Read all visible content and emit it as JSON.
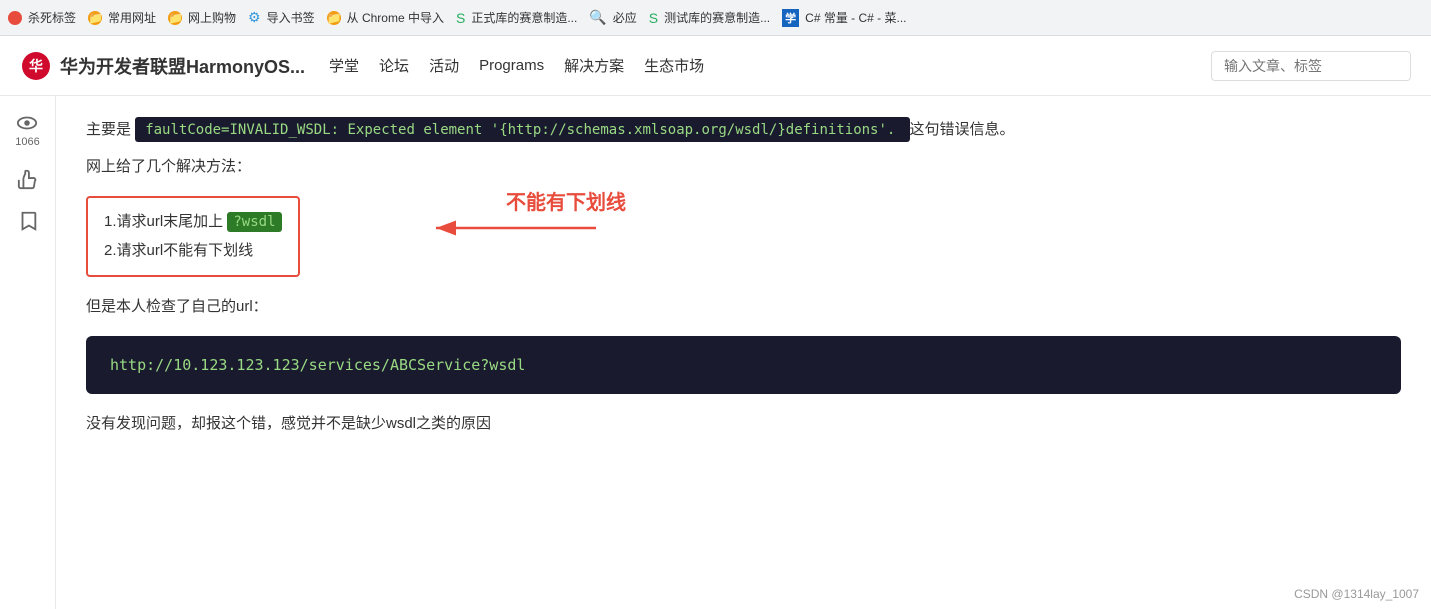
{
  "browser": {
    "tabs": [
      {
        "label": "杀死标签",
        "iconColor": "red"
      },
      {
        "label": "常用网址",
        "iconColor": "orange"
      },
      {
        "label": "网上购物",
        "iconColor": "orange"
      },
      {
        "label": "导入书签",
        "iconColor": "blue"
      },
      {
        "label": "从 Chrome 中导入",
        "iconColor": "orange"
      },
      {
        "label": "正式库的赛意制造...",
        "iconColor": "green"
      },
      {
        "label": "必应",
        "iconColor": "blue"
      },
      {
        "label": "测试库的赛意制造...",
        "iconColor": "green"
      },
      {
        "label": "C# 常量 - C# - 菜...",
        "iconColor": "cyan"
      }
    ]
  },
  "header": {
    "logo_alt": "Huawei Logo",
    "site_title": "华为开发者联盟HarmonyOS...",
    "nav": [
      "学堂",
      "论坛",
      "活动",
      "Programs",
      "解决方案",
      "生态市场"
    ],
    "search_placeholder": "输入文章、标签"
  },
  "sidebar": {
    "items": [
      {
        "icon": "eye",
        "label": "1066"
      },
      {
        "icon": "thumbup",
        "label": ""
      },
      {
        "icon": "bookmark",
        "label": ""
      }
    ]
  },
  "content": {
    "intro_text": "主要是",
    "error_code": "faultCode=INVALID_WSDL: Expected element '{http://schemas.xmlsoap.org/wsdl/}definitions'.",
    "intro_suffix": "这句错误信息。",
    "solutions_title": "网上给了几个解决方法：",
    "solution1_prefix": "1.请求url末尾加上",
    "solution1_highlight": "?wsdl",
    "solution2": "2.请求url不能有下划线",
    "annotation": "不能有下划线",
    "url_check_text": "但是本人检查了自己的url：",
    "code_url": "http://10.123.123.123/services/ABCService?wsdl",
    "no_issue_text": "没有发现问题，却报这个错，感觉并不是缺少wsdl之类的原因",
    "watermark": "CSDN @1314lay_1007"
  }
}
